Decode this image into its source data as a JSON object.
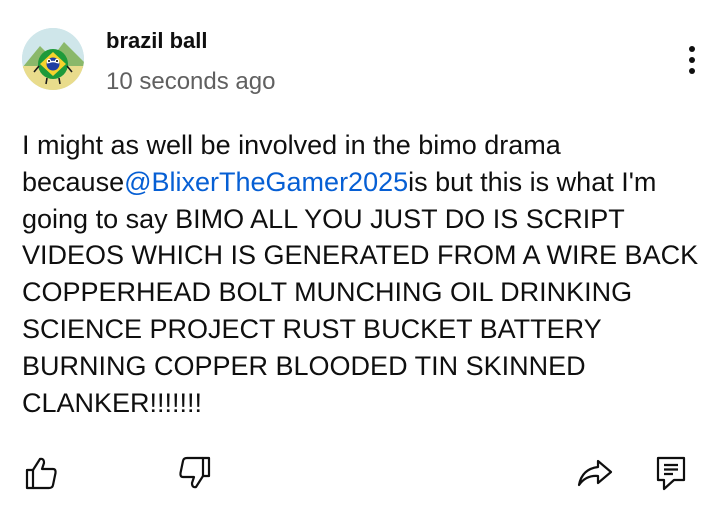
{
  "comment": {
    "author": "brazil ball",
    "timestamp": "10 seconds ago",
    "text_before_mention": "I might as well be involved in the bimo drama because",
    "mention": "@BlixerTheGamer2025",
    "text_after_mention": "is but this is what I'm going to say BIMO ALL YOU JUST DO IS SCRIPT VIDEOS WHICH IS GENERATED FROM A WIRE BACK COPPERHEAD BOLT MUNCHING OIL DRINKING SCIENCE PROJECT RUST BUCKET BATTERY BURNING COPPER BLOODED TIN SKINNED CLANKER!!!!!!!"
  },
  "icons": {
    "more": "more-vertical-icon",
    "like": "thumbs-up-icon",
    "dislike": "thumbs-down-icon",
    "share": "share-icon",
    "reply": "reply-comment-icon"
  },
  "colors": {
    "mention": "#065fd4",
    "meta": "#606060",
    "text": "#0f0f0f"
  }
}
